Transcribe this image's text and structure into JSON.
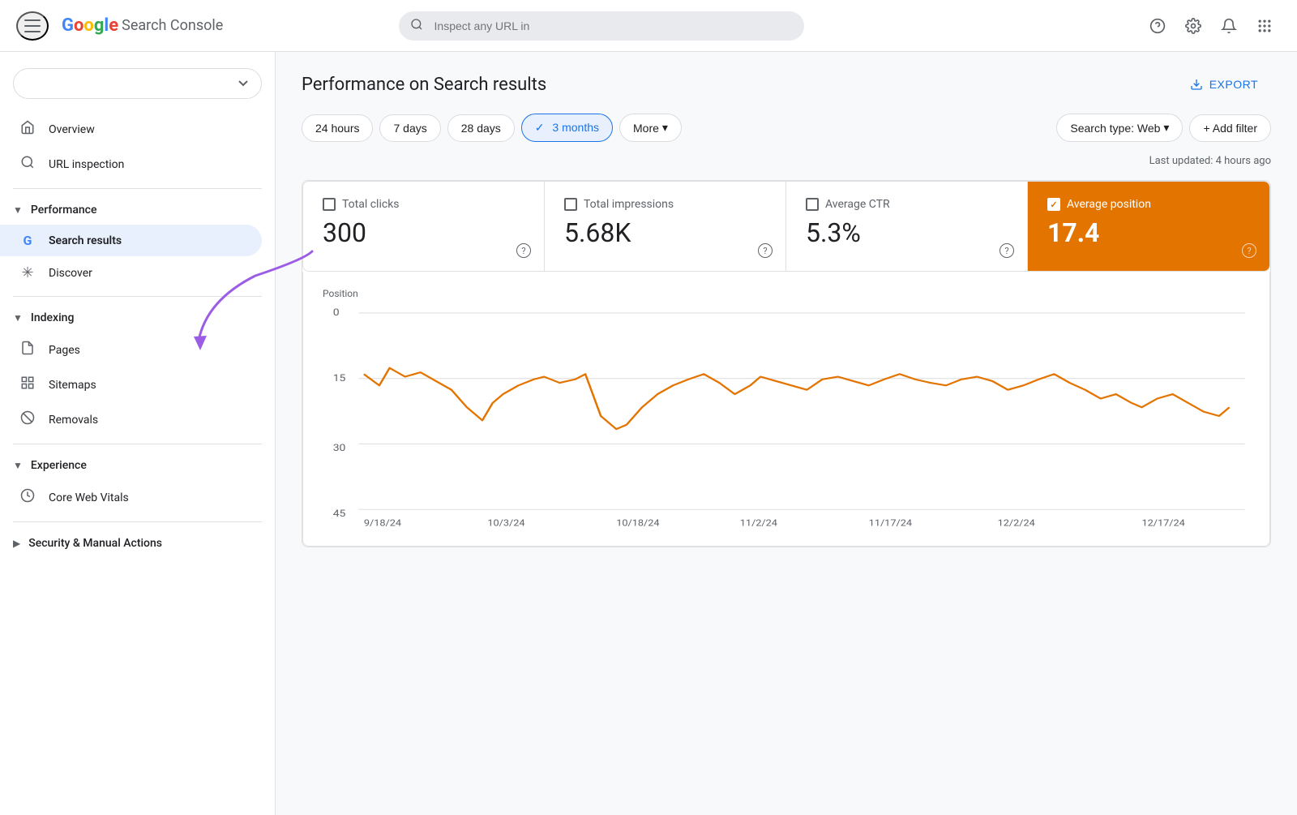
{
  "header": {
    "search_placeholder": "Inspect any URL in",
    "app_name": "Search Console",
    "google_colors": {
      "g1": "#4285f4",
      "g2": "#ea4335",
      "g3": "#fbbc04",
      "g4": "#34a853"
    }
  },
  "sidebar": {
    "property_selector_placeholder": "",
    "items": [
      {
        "id": "overview",
        "label": "Overview",
        "icon": "🏠"
      },
      {
        "id": "url-inspection",
        "label": "URL inspection",
        "icon": "🔍"
      }
    ],
    "sections": [
      {
        "id": "performance",
        "label": "Performance",
        "expanded": true,
        "items": [
          {
            "id": "search-results",
            "label": "Search results",
            "icon": "G",
            "active": true
          },
          {
            "id": "discover",
            "label": "Discover",
            "icon": "✳"
          }
        ]
      },
      {
        "id": "indexing",
        "label": "Indexing",
        "expanded": true,
        "items": [
          {
            "id": "pages",
            "label": "Pages",
            "icon": "📄"
          },
          {
            "id": "sitemaps",
            "label": "Sitemaps",
            "icon": "🗺"
          },
          {
            "id": "removals",
            "label": "Removals",
            "icon": "🚫"
          }
        ]
      },
      {
        "id": "experience",
        "label": "Experience",
        "expanded": true,
        "items": [
          {
            "id": "core-web-vitals",
            "label": "Core Web Vitals",
            "icon": "⏱"
          }
        ]
      },
      {
        "id": "security",
        "label": "Security & Manual Actions",
        "expanded": false,
        "items": []
      }
    ]
  },
  "content": {
    "page_title": "Performance on Search results",
    "export_label": "EXPORT",
    "last_updated": "Last updated: 4 hours ago",
    "time_filters": [
      {
        "id": "24h",
        "label": "24 hours",
        "active": false
      },
      {
        "id": "7d",
        "label": "7 days",
        "active": false
      },
      {
        "id": "28d",
        "label": "28 days",
        "active": false
      },
      {
        "id": "3m",
        "label": "3 months",
        "active": true
      },
      {
        "id": "more",
        "label": "More",
        "active": false
      }
    ],
    "search_type_label": "Search type: Web",
    "add_filter_label": "+ Add filter",
    "metrics": [
      {
        "id": "total-clicks",
        "label": "Total clicks",
        "value": "300",
        "checked": false,
        "selected": false,
        "color": "#1a73e8"
      },
      {
        "id": "total-impressions",
        "label": "Total impressions",
        "value": "5.68K",
        "checked": false,
        "selected": false,
        "color": "#34a853"
      },
      {
        "id": "average-ctr",
        "label": "Average CTR",
        "value": "5.3%",
        "checked": false,
        "selected": false,
        "color": "#ea4335"
      },
      {
        "id": "average-position",
        "label": "Average position",
        "value": "17.4",
        "checked": true,
        "selected": true,
        "color": "#e37400"
      }
    ],
    "chart": {
      "y_label": "Position",
      "y_axis": [
        "0",
        "15",
        "30",
        "45"
      ],
      "x_axis": [
        "9/18/24",
        "10/3/24",
        "10/18/24",
        "11/2/24",
        "11/17/24",
        "12/2/24",
        "12/17/24"
      ],
      "color": "#e37400"
    }
  }
}
